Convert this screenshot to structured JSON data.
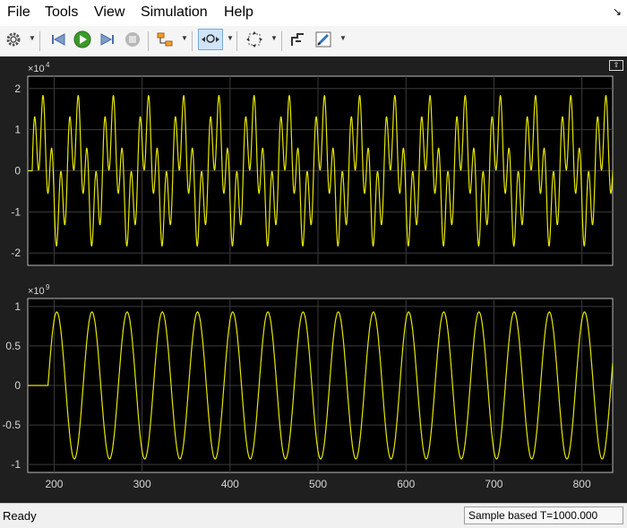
{
  "menu": {
    "file": "File",
    "tools": "Tools",
    "view": "View",
    "simulation": "Simulation",
    "help": "Help"
  },
  "toolbar": {
    "buttons": [
      "gear-icon",
      "step-back-icon",
      "run-icon",
      "step-forward-icon",
      "stop-icon",
      "signal-select-icon",
      "zoom-icon",
      "fit-to-view-icon",
      "measurements-icon",
      "style-icon"
    ]
  },
  "colors": {
    "trace": "#e6e600",
    "axes_bg": "#000000",
    "panel_bg": "#1f1f1f",
    "grid": "#3c3c3c",
    "text": "#d8d8d8"
  },
  "status": {
    "ready": "Ready",
    "sample_info": "Sample based  T=1000.000"
  },
  "chart_data": [
    {
      "type": "line",
      "exponent_label": "×10",
      "exponent_power": "4",
      "xlim": [
        170,
        835
      ],
      "ylim": [
        -2.3,
        2.3
      ],
      "xticks": [
        200,
        300,
        400,
        500,
        600,
        700,
        800
      ],
      "yticks": [
        2,
        1,
        0,
        -1,
        -2
      ],
      "ytick_labels": [
        "2",
        "1",
        "0",
        "-1",
        "-2"
      ],
      "grid": true,
      "series": [
        {
          "components": [
            {
              "amplitude": 1.0,
              "period": 40.0,
              "phase_start": 175
            },
            {
              "amplitude": 0.9,
              "period": 10.0,
              "phase_start": 175
            }
          ],
          "start": 175
        }
      ]
    },
    {
      "type": "line",
      "exponent_label": "×10",
      "exponent_power": "9",
      "xlim": [
        170,
        835
      ],
      "ylim": [
        -1.1,
        1.1
      ],
      "xticks": [
        200,
        300,
        400,
        500,
        600,
        700,
        800
      ],
      "xtick_labels": [
        "200",
        "300",
        "400",
        "500",
        "600",
        "700",
        "800"
      ],
      "yticks": [
        1,
        0.5,
        0,
        -0.5,
        -1
      ],
      "ytick_labels": [
        "1",
        "0.5",
        "0",
        "-0.5",
        "-1"
      ],
      "grid": true,
      "series": [
        {
          "amplitude": 0.93,
          "period": 40.0,
          "start": 193,
          "baseline": 0
        }
      ]
    }
  ]
}
